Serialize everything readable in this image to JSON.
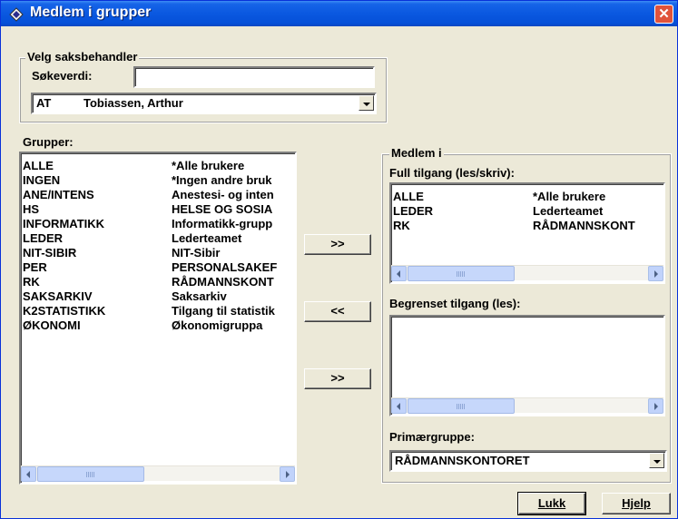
{
  "window": {
    "title": "Medlem i grupper",
    "close_glyph": "✕"
  },
  "velg": {
    "legend": "Velg saksbehandler",
    "search_label": "Søkeverdi:",
    "search_value": "",
    "selected_code": "AT",
    "selected_name": "Tobiassen, Arthur"
  },
  "grupper": {
    "label": "Grupper:",
    "rows": [
      {
        "code": "ALLE",
        "name": "*Alle brukere"
      },
      {
        "code": "INGEN",
        "name": "*Ingen andre bruk"
      },
      {
        "code": "ANE/INTENS",
        "name": "Anestesi- og inten"
      },
      {
        "code": "HS",
        "name": "HELSE OG SOSIA"
      },
      {
        "code": "INFORMATIKK",
        "name": "Informatikk-grupp"
      },
      {
        "code": "LEDER",
        "name": "Lederteamet"
      },
      {
        "code": "NIT-SIBIR",
        "name": "NIT-Sibir"
      },
      {
        "code": "PER",
        "name": "PERSONALSAKEF"
      },
      {
        "code": "RK",
        "name": "RÅDMANNSKONT"
      },
      {
        "code": "SAKSARKIV",
        "name": "Saksarkiv"
      },
      {
        "code": "K2STATISTIKK",
        "name": "Tilgang til statistik"
      },
      {
        "code": "ØKONOMI",
        "name": "Økonomigruppa"
      }
    ]
  },
  "buttons": {
    "add_full": ">>",
    "remove": "<<",
    "add_limited": ">>",
    "lukk": "Lukk",
    "hjelp": "Hjelp"
  },
  "medlem": {
    "legend": "Medlem i",
    "full_label": "Full tilgang (les/skriv):",
    "full_rows": [
      {
        "code": "ALLE",
        "name": "*Alle brukere"
      },
      {
        "code": "LEDER",
        "name": "Lederteamet"
      },
      {
        "code": "RK",
        "name": "RÅDMANNSKONT"
      }
    ],
    "limited_label": "Begrenset tilgang (les):",
    "primary_label": "Primærgruppe:",
    "primary_value": "RÅDMANNSKONTORET"
  },
  "colors": {
    "titlebar": "#0a58e0",
    "dialog_bg": "#ece9d8",
    "close": "#e0533b"
  }
}
